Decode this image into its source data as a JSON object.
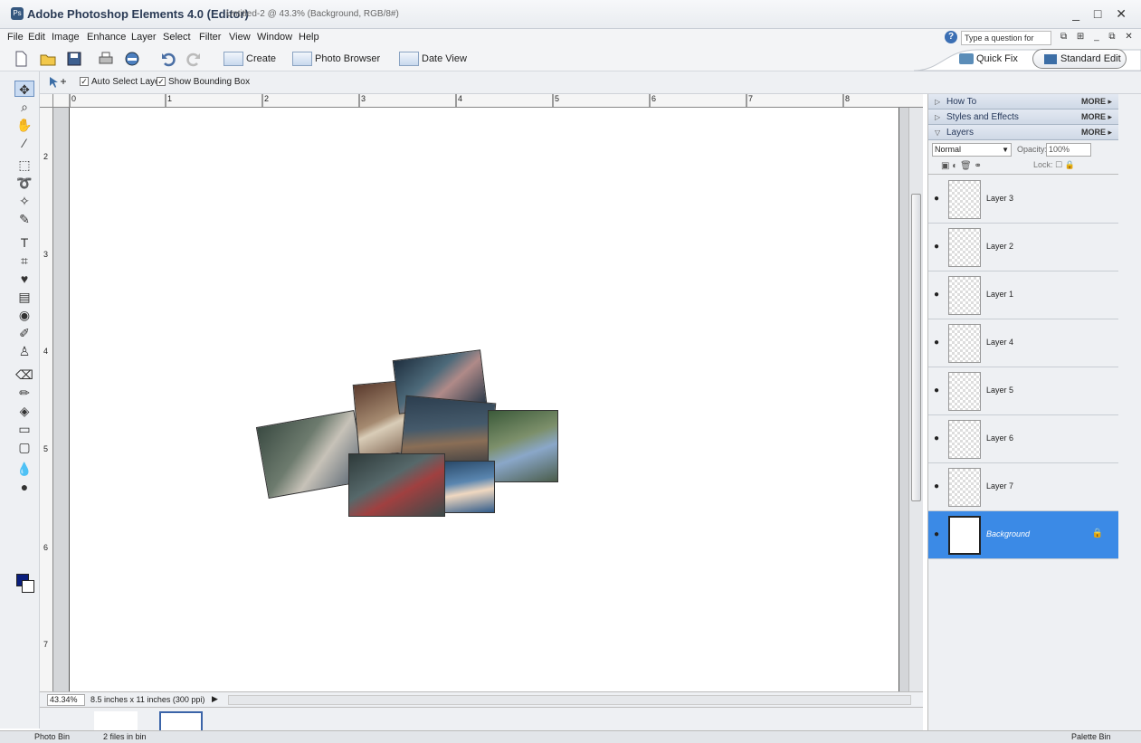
{
  "window": {
    "app_title": "Adobe Photoshop Elements 4.0 (Editor)",
    "doc_title": "Untitled-2 @ 43.3% (Background, RGB/8#)",
    "controls": "_ □ ✕"
  },
  "menu": {
    "items": [
      "File",
      "Edit",
      "Image",
      "Enhance",
      "Layer",
      "Select",
      "Filter",
      "View",
      "Window",
      "Help"
    ],
    "help_placeholder": "Type a question for help",
    "doc_controls": "⧉ ⊞ _ ⧉ ✕"
  },
  "shortcuts": {
    "create": "Create",
    "photo_browser": "Photo Browser",
    "date_view": "Date View",
    "quick_fix": "Quick Fix",
    "standard_edit": "Standard Edit"
  },
  "options": {
    "auto_select": "Auto Select Layer",
    "show_bbox": "Show Bounding Box",
    "checked": "✓"
  },
  "rulers": {
    "h": [
      "0",
      "1",
      "2",
      "3",
      "4",
      "5",
      "6",
      "7",
      "8"
    ],
    "v": [
      "2",
      "3",
      "4",
      "5",
      "6",
      "7"
    ]
  },
  "status": {
    "zoom": "43.34%",
    "doc_info": "8.5 inches x 11 inches (300 ppi)"
  },
  "bottom": {
    "photo_bin": "Photo Bin",
    "files_count": "2 files in bin",
    "palette_bin": "Palette Bin"
  },
  "palette": {
    "how_to": "How To",
    "styles": "Styles and Effects",
    "layers": "Layers",
    "more": "MORE ▸",
    "blend_mode": "Normal",
    "opacity_label": "Opacity:",
    "opacity": "100%",
    "lock_label": "Lock:",
    "layer_names": [
      "Layer 3",
      "Layer 2",
      "Layer 1",
      "Layer 4",
      "Layer 5",
      "Layer 6",
      "Layer 7",
      "Background"
    ]
  }
}
